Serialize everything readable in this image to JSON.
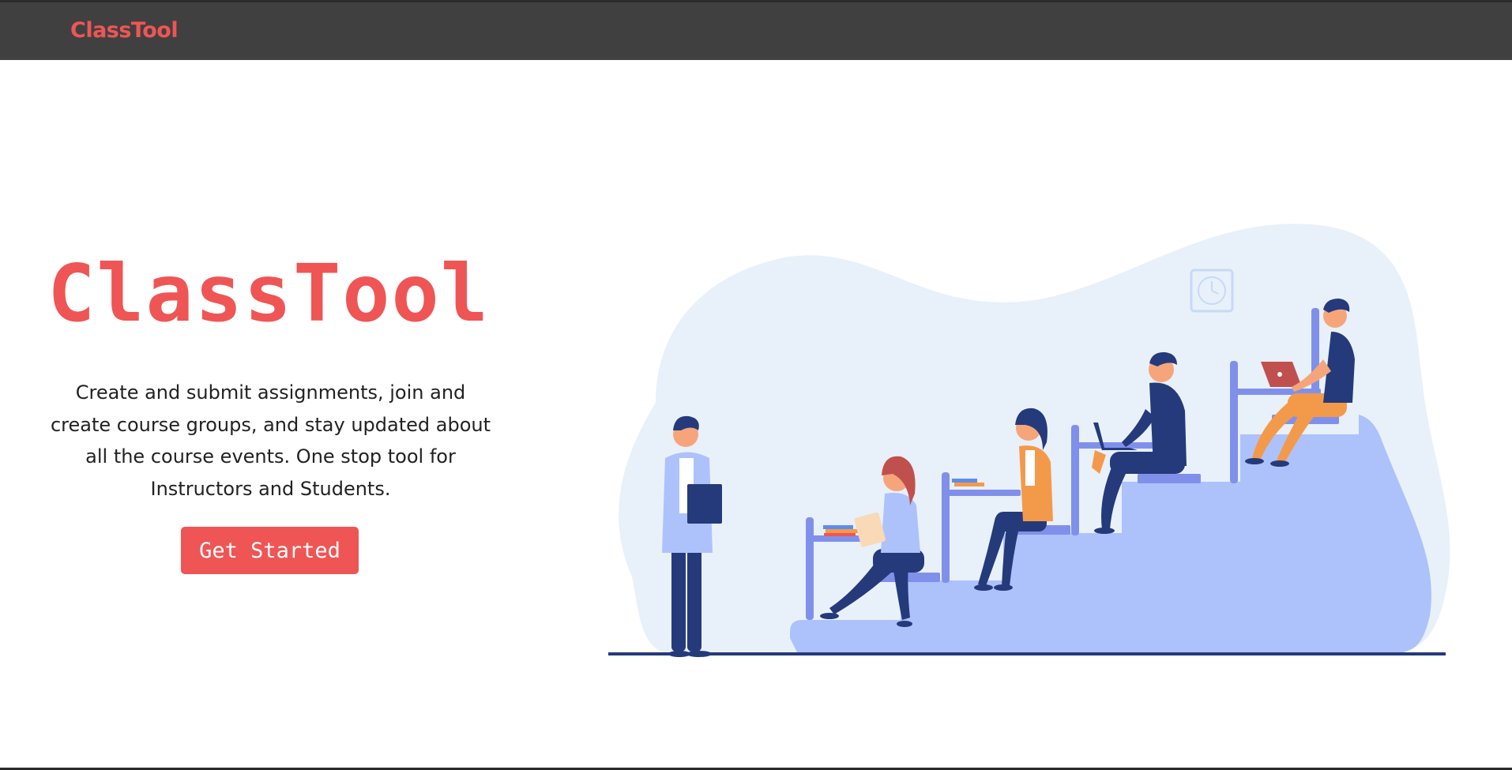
{
  "navbar": {
    "brand": "ClassTool"
  },
  "hero": {
    "title": "ClassTool",
    "description": "Create and submit assignments, join and create course groups, and stay updated about all the course events. One stop tool for Instructors and Students.",
    "cta_label": "Get Started"
  },
  "colors": {
    "brand": "#ef5555",
    "navbar_bg": "#404040",
    "illustration_blob": "#e8f0fa",
    "illustration_stairs": "#adc2fb",
    "illustration_accent": "#8090ea",
    "illustration_navy": "#253a7a",
    "illustration_orange": "#f39a4a"
  }
}
